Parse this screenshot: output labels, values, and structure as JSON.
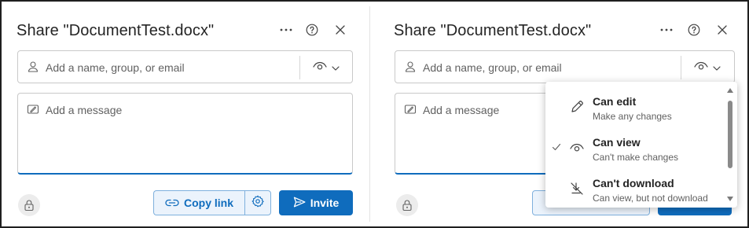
{
  "left_dialog": {
    "title": "Share \"DocumentTest.docx\"",
    "people_placeholder": "Add a name, group, or email",
    "message_placeholder": "Add a message",
    "copy_link_label": "Copy link",
    "invite_label": "Invite"
  },
  "right_dialog": {
    "title": "Share \"DocumentTest.docx\"",
    "people_placeholder": "Add a name, group, or email",
    "message_placeholder": "Add a message"
  },
  "permission_menu": {
    "items": [
      {
        "label": "Can edit",
        "description": "Make any changes",
        "icon": "pencil-icon",
        "selected": false
      },
      {
        "label": "Can view",
        "description": "Can't make changes",
        "icon": "eye-icon",
        "selected": true
      },
      {
        "label": "Can't download",
        "description": "Can view, but not download",
        "icon": "no-download-icon",
        "selected": false
      }
    ]
  },
  "icons": {
    "more": "more-options-icon",
    "help": "help-icon",
    "close": "close-icon",
    "person": "person-icon",
    "message": "message-icon",
    "permission": "eye-icon",
    "chevron": "chevron-down-icon",
    "lock": "lock-icon",
    "link": "link-icon",
    "settings": "gear-icon",
    "send": "send-icon",
    "check": "checkmark-icon"
  },
  "colors": {
    "accent": "#0f6cbd",
    "accent_light": "#ebf3fc",
    "border": "#c9c9c9",
    "text": "#242424",
    "placeholder": "#616161"
  }
}
